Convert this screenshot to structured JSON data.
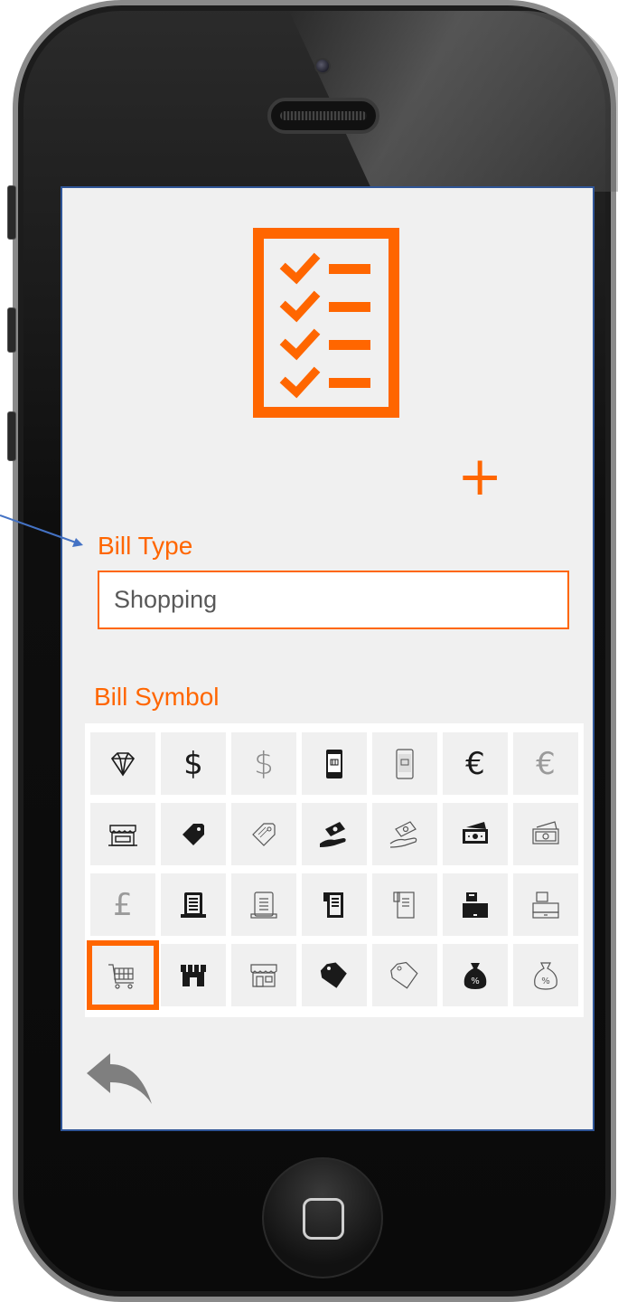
{
  "form": {
    "bill_type_label": "Bill Type",
    "bill_type_value": "Shopping",
    "bill_symbol_label": "Bill Symbol",
    "selected_symbol": "shopping-cart"
  },
  "symbols": [
    [
      "diamond-icon",
      "dollar-icon",
      "dollar-thin-icon",
      "mobile-cart-icon",
      "mobile-cart-thin-icon",
      "euro-icon",
      "euro-thin-icon"
    ],
    [
      "store-awning-icon",
      "price-tag-icon",
      "price-tag-thin-icon",
      "hand-cash-icon",
      "hand-cash-thin-icon",
      "cash-bill-icon",
      "cash-bill-thin-icon"
    ],
    [
      "pound-thin-icon",
      "receipt-icon",
      "receipt-thin-icon",
      "receipt-roll-icon",
      "receipt-roll-thin-icon",
      "cash-register-icon",
      "cash-register-thin-icon"
    ],
    [
      "shopping-cart-icon",
      "shop-icon",
      "shop-thin-icon",
      "tag-solid-icon",
      "tag-outline-icon",
      "money-bag-icon",
      "money-bag-thin-icon"
    ]
  ],
  "glyphs": {
    "dollar": "$",
    "euro": "€",
    "pound": "£",
    "percent": "%",
    "add": "+"
  },
  "colors": {
    "accent": "#ff6600",
    "screen_bg": "#f0f0f0",
    "screen_border": "#2f5597",
    "icon_dark": "#1a1a1a",
    "icon_light": "#8a8a8a"
  }
}
